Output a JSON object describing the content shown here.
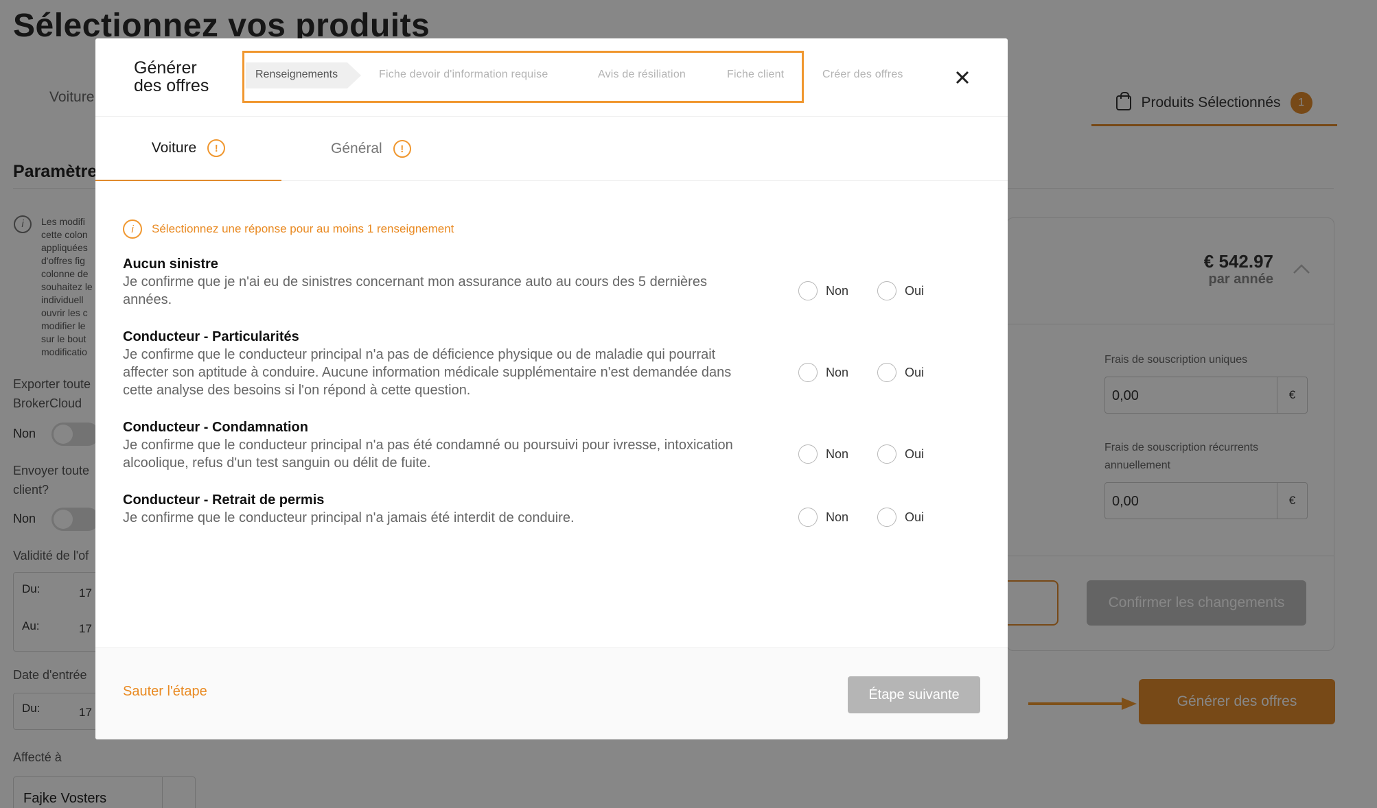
{
  "background": {
    "page_title": "Sélectionnez vos produits",
    "tab_voiture": "Voiture",
    "selected_products_label": "Produits Sélectionnés",
    "selected_count": "1",
    "section_heading": "Paramètre",
    "info_text": "Les modifi cette colon appliquées d'offres fig colonne de souhaitez le individuell ouvrir les c modifier le sur le bout modificatio",
    "export_label": "Exporter toute BrokerCloud",
    "export_value": "Non",
    "send_label": "Envoyer toute client?",
    "send_value": "Non",
    "validity_label": "Validité de l'of",
    "date_from_label": "Du:",
    "date_from_value": "17",
    "date_to_label": "Au:",
    "date_to_value": "17",
    "entry_label": "Date d'entrée",
    "entry_from_label": "Du:",
    "entry_from_value": "17",
    "assigned_label": "Affecté à",
    "assigned_value": "Fajke Vosters",
    "price": "€ 542.97",
    "price_period": "par année",
    "fee_once_label": "Frais de souscription uniques",
    "fee_once_value": "0,00",
    "fee_recurring_label": "Frais de souscription récurrents annuellement",
    "fee_recurring_value": "0,00",
    "currency": "€",
    "confirm_button": "Confirmer les changements",
    "generate_button": "Générer des offres"
  },
  "modal": {
    "title_line1": "Générer",
    "title_line2": "des offres",
    "steps": [
      "Renseignements",
      "Fiche devoir d'information requise",
      "Avis de résiliation",
      "Fiche client",
      "Créer des offres"
    ],
    "active_step": "Renseignements",
    "tabs": [
      {
        "label": "Voiture",
        "warning": "!"
      },
      {
        "label": "Général",
        "warning": "!"
      }
    ],
    "notice": "Sélectionnez une réponse pour au moins 1 renseignement",
    "notice_icon": "i",
    "options": {
      "no": "Non",
      "yes": "Oui"
    },
    "questions": [
      {
        "title": "Aucun sinistre",
        "desc": "Je confirme que je n'ai eu de sinistres concernant mon assurance auto au cours des 5 dernières années."
      },
      {
        "title": "Conducteur - Particularités",
        "desc": "Je confirme que le conducteur principal n'a pas de déficience physique ou de maladie qui pourrait affecter son aptitude à conduire. Aucune information médicale supplémentaire n'est demandée dans cette analyse des besoins si l'on répond à cette question."
      },
      {
        "title": "Conducteur - Condamnation",
        "desc": "Je confirme que le conducteur principal n'a pas été condamné ou poursuivi pour ivresse, intoxication alcoolique, refus d'un test sanguin ou délit de fuite."
      },
      {
        "title": "Conducteur - Retrait de permis",
        "desc": "Je confirme que le conducteur principal n'a jamais été interdit de conduire."
      }
    ],
    "skip_label": "Sauter l'étape",
    "next_label": "Étape suivante"
  },
  "colors": {
    "accent": "#e08a2d",
    "highlight_box": "#f0972f",
    "disabled": "#b5b5b5"
  }
}
